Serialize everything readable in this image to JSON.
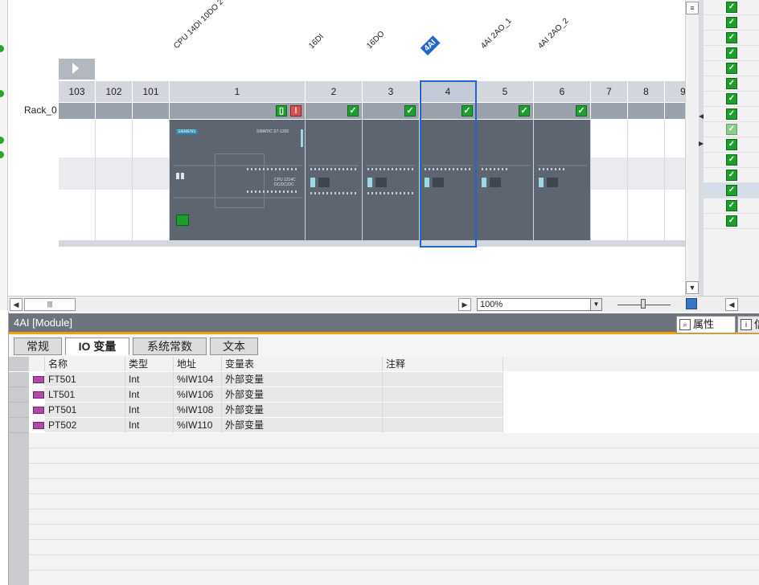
{
  "rack": {
    "name": "Rack_0"
  },
  "modules": [
    {
      "title": "CPU 14DI 10DO 2",
      "selected": false
    },
    {
      "title": "16DI",
      "selected": false
    },
    {
      "title": "16DO",
      "selected": false
    },
    {
      "title": "4AI",
      "selected": true
    },
    {
      "title": "4AI 2AO_1",
      "selected": false
    },
    {
      "title": "4AI 2AO_2",
      "selected": false
    }
  ],
  "slots": [
    "103",
    "102",
    "101",
    "1",
    "2",
    "3",
    "4",
    "5",
    "6",
    "7",
    "8",
    "9"
  ],
  "module_labels": {
    "brand": "SIEMENS",
    "cpu_model": "SIMATIC S7-1200",
    "cpu_type": "CPU 1214C DC/DC/DC"
  },
  "toolbar": {
    "zoom": "100%"
  },
  "inspector": {
    "title": "4AI [Module]",
    "panel_tabs": [
      {
        "label": "属性"
      },
      {
        "label": "信"
      }
    ],
    "tabs": [
      "常规",
      "IO 变量",
      "系统常数",
      "文本"
    ],
    "active_tab": "IO 变量",
    "columns": [
      "名称",
      "类型",
      "地址",
      "变量表",
      "注释"
    ],
    "rows": [
      {
        "name": "FT501",
        "type": "Int",
        "address": "%IW104",
        "table": "外部变量",
        "comment": ""
      },
      {
        "name": "LT501",
        "type": "Int",
        "address": "%IW106",
        "table": "外部变量",
        "comment": ""
      },
      {
        "name": "PT501",
        "type": "Int",
        "address": "%IW108",
        "table": "外部变量",
        "comment": ""
      },
      {
        "name": "PT502",
        "type": "Int",
        "address": "%IW110",
        "table": "外部变量",
        "comment": ""
      }
    ]
  },
  "colors": {
    "accent": "#f2a200",
    "selection": "#2266cc",
    "ok": "#1e9e2e"
  }
}
